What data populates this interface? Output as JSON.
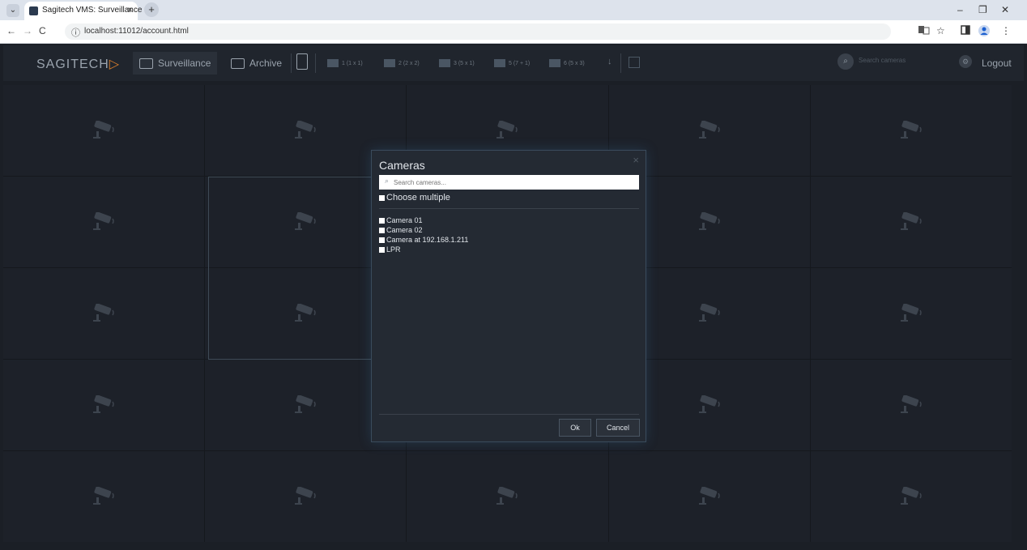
{
  "browser": {
    "tab_title": "Sagitech VMS: Surveillance",
    "tab_close": "×",
    "new_tab": "+",
    "tab_dropdown": "⌄",
    "window_minimize": "–",
    "window_restore": "❐",
    "window_close": "✕",
    "url": "localhost:11012/account.html",
    "nav_back": "←",
    "nav_forward": "→",
    "nav_reload": "C",
    "site_info": "ⓘ",
    "tools": [
      "translate-icon",
      "star-icon",
      "sidepanel-icon",
      "profile-icon",
      "menu-icon"
    ]
  },
  "header": {
    "logo_text": "SAGITECH",
    "logo_mark": "▷",
    "nav": [
      {
        "label": "Surveillance",
        "icon": "monitor-icon",
        "active": true
      },
      {
        "label": "Archive",
        "icon": "folder-icon",
        "active": false
      }
    ],
    "layouts": [
      {
        "label": "1 (1 x 1)"
      },
      {
        "label": "2 (2 x 2)"
      },
      {
        "label": "3 (5 x 1)"
      },
      {
        "label": "5 (7 + 1)"
      },
      {
        "label": "6 (5 x 3)"
      }
    ],
    "search_placeholder": "Search cameras",
    "logout_label": "Logout"
  },
  "grid": {
    "rows": 5,
    "columns": 5
  },
  "modal": {
    "title": "Cameras",
    "close": "×",
    "search_placeholder": "Search cameras...",
    "choose_multiple": "Choose multiple",
    "cameras": [
      {
        "label": "Camera 01",
        "checked": false
      },
      {
        "label": "Camera 02",
        "checked": false
      },
      {
        "label": "Camera at 192.168.1.211",
        "checked": false
      },
      {
        "label": "LPR",
        "checked": false
      }
    ],
    "ok_label": "Ok",
    "cancel_label": "Cancel"
  },
  "colors": {
    "background": "#1b1f26",
    "header": "#20252d",
    "modal_border": "#3a4b5c",
    "accent": "#d97d2b"
  }
}
